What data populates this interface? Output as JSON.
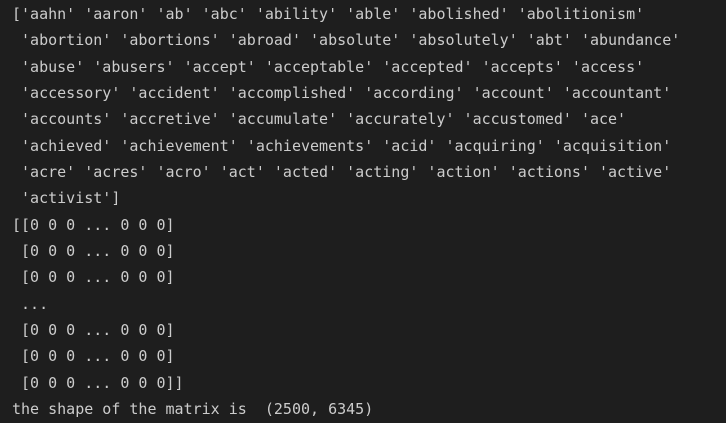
{
  "output": {
    "lines": [
      "['aahn' 'aaron' 'ab' 'abc' 'ability' 'able' 'abolished' 'abolitionism'",
      " 'abortion' 'abortions' 'abroad' 'absolute' 'absolutely' 'abt' 'abundance'",
      " 'abuse' 'abusers' 'accept' 'acceptable' 'accepted' 'accepts' 'access'",
      " 'accessory' 'accident' 'accomplished' 'according' 'account' 'accountant'",
      " 'accounts' 'accretive' 'accumulate' 'accurately' 'accustomed' 'ace'",
      " 'achieved' 'achievement' 'achievements' 'acid' 'acquiring' 'acquisition'",
      " 'acre' 'acres' 'acro' 'act' 'acted' 'acting' 'action' 'actions' 'active'",
      " 'activist']",
      "[[0 0 0 ... 0 0 0]",
      " [0 0 0 ... 0 0 0]",
      " [0 0 0 ... 0 0 0]",
      " ...",
      " [0 0 0 ... 0 0 0]",
      " [0 0 0 ... 0 0 0]",
      " [0 0 0 ... 0 0 0]]",
      "the shape of the matrix is  (2500, 6345)"
    ]
  }
}
